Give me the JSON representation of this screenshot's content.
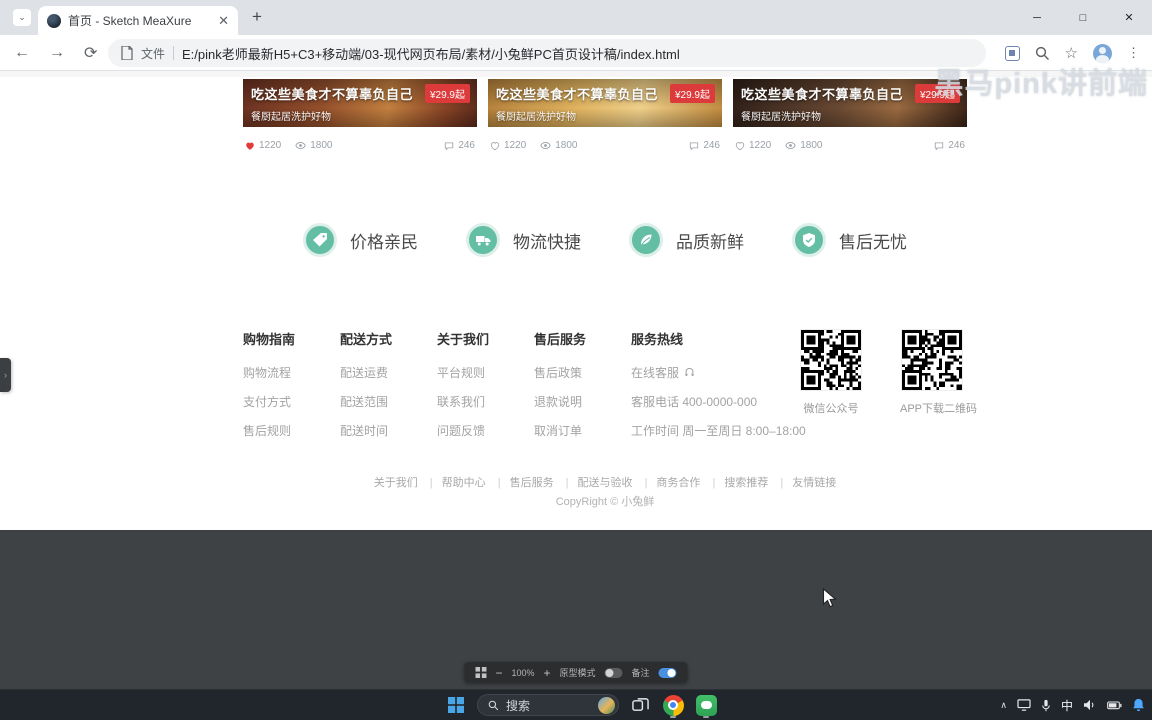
{
  "browser": {
    "tab_title": "首页 - Sketch MeaXure",
    "scheme_label": "文件",
    "url": "E:/pink老师最新H5+C3+移动端/03-现代网页布局/素材/小兔鲜PC首页设计稿/index.html",
    "watermark": "黑马pink讲前端"
  },
  "cards": [
    {
      "title": "吃这些美食才不算辜负自己",
      "price": "¥29.9起",
      "subtitle": "餐厨起居洗护好物",
      "likes": "1220",
      "views": "1800",
      "comments": "246",
      "liked": true
    },
    {
      "title": "吃这些美食才不算辜负自己",
      "price": "¥29.9起",
      "subtitle": "餐厨起居洗护好物",
      "likes": "1220",
      "views": "1800",
      "comments": "246",
      "liked": false
    },
    {
      "title": "吃这些美食才不算辜负自己",
      "price": "¥29.9起",
      "subtitle": "餐厨起居洗护好物",
      "likes": "1220",
      "views": "1800",
      "comments": "246",
      "liked": false
    }
  ],
  "features": [
    {
      "label": "价格亲民"
    },
    {
      "label": "物流快捷"
    },
    {
      "label": "品质新鲜"
    },
    {
      "label": "售后无忧"
    }
  ],
  "footer": {
    "columns": [
      {
        "title": "购物指南",
        "links": [
          "购物流程",
          "支付方式",
          "售后规则"
        ]
      },
      {
        "title": "配送方式",
        "links": [
          "配送运费",
          "配送范围",
          "配送时间"
        ]
      },
      {
        "title": "关于我们",
        "links": [
          "平台规则",
          "联系我们",
          "问题反馈"
        ]
      },
      {
        "title": "售后服务",
        "links": [
          "售后政策",
          "退款说明",
          "取消订单"
        ]
      },
      {
        "title": "服务热线",
        "links": [
          "在线客服",
          "客服电话 400-0000-000",
          "工作时间 周一至周日 8:00–18:00"
        ]
      }
    ],
    "qrcodes": [
      {
        "label": "微信公众号"
      },
      {
        "label": "APP下载二维码"
      }
    ],
    "bottom_links": [
      "关于我们",
      "帮助中心",
      "售后服务",
      "配送与验收",
      "商务合作",
      "搜索推荐",
      "友情链接"
    ],
    "copyright": "CopyRight © 小兔鲜"
  },
  "viewer": {
    "zoom": "100%",
    "prototype_label": "原型模式",
    "notes_label": "备注"
  },
  "taskbar": {
    "search_placeholder": "搜索",
    "ime_label": "中"
  },
  "colors": {
    "accent_green": "#5eb69c",
    "badge_red": "#dd3b3b",
    "toggle_on_blue": "#4a90e2",
    "notify_blue": "#4fa8ff"
  }
}
